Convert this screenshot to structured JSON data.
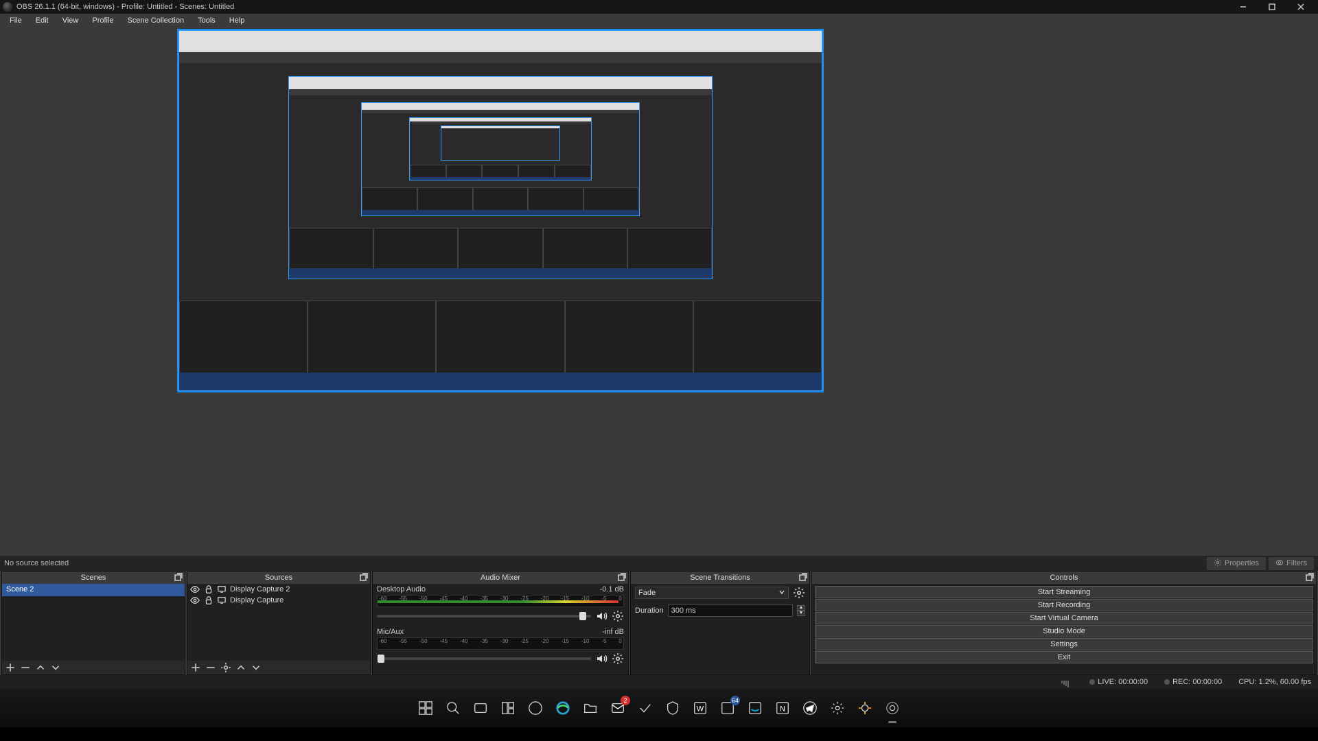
{
  "title": "OBS 26.1.1 (64-bit, windows) - Profile: Untitled - Scenes: Untitled",
  "menu": {
    "file": "File",
    "edit": "Edit",
    "view": "View",
    "profile": "Profile",
    "sceneCollection": "Scene Collection",
    "tools": "Tools",
    "help": "Help"
  },
  "srcbar": {
    "noSource": "No source selected",
    "properties": "Properties",
    "filters": "Filters"
  },
  "docks": {
    "scenes": "Scenes",
    "sources": "Sources",
    "mixer": "Audio Mixer",
    "transitions": "Scene Transitions",
    "controls": "Controls"
  },
  "scenes": {
    "items": [
      "Scene 2"
    ]
  },
  "sources": {
    "items": [
      {
        "name": "Display Capture 2",
        "visible": true,
        "locked": false
      },
      {
        "name": "Display Capture",
        "visible": true,
        "locked": false
      }
    ]
  },
  "mixer": {
    "ticks": [
      "-60",
      "-55",
      "-50",
      "-45",
      "-40",
      "-35",
      "-30",
      "-25",
      "-20",
      "-15",
      "-10",
      "-5",
      "0"
    ],
    "channels": [
      {
        "name": "Desktop Audio",
        "level": "-0.1 dB",
        "barPct": 98,
        "sliderPct": 96
      },
      {
        "name": "Mic/Aux",
        "level": "-inf dB",
        "barPct": 0,
        "sliderPct": 2
      }
    ]
  },
  "transitions": {
    "selected": "Fade",
    "durationLabel": "Duration",
    "durationValue": "300 ms"
  },
  "controls": {
    "startStreaming": "Start Streaming",
    "startRecording": "Start Recording",
    "startVirtualCamera": "Start Virtual Camera",
    "studioMode": "Studio Mode",
    "settings": "Settings",
    "exit": "Exit"
  },
  "status": {
    "live": "LIVE: 00:00:00",
    "rec": "REC: 00:00:00",
    "cpu": "CPU: 1.2%, 60.00 fps"
  },
  "taskbar": {
    "mailBadge": "2",
    "cpuBadge": "64"
  }
}
